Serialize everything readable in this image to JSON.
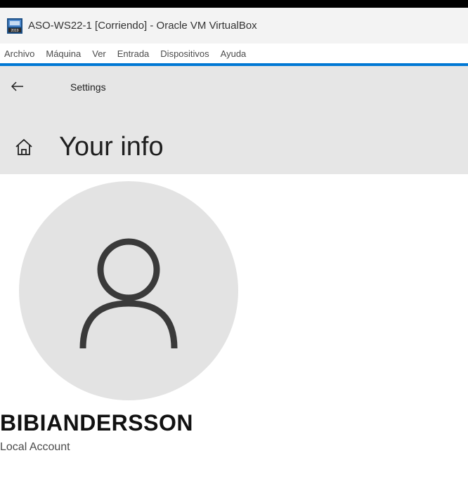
{
  "window": {
    "title": "ASO-WS22-1 [Corriendo] - Oracle VM VirtualBox",
    "app_icon": "virtualbox-icon"
  },
  "menubar": {
    "items": [
      "Archivo",
      "Máquina",
      "Ver",
      "Entrada",
      "Dispositivos",
      "Ayuda"
    ]
  },
  "settings": {
    "back_icon": "back-arrow-icon",
    "app_label": "Settings",
    "home_icon": "home-icon",
    "page_title": "Your info"
  },
  "profile": {
    "avatar_icon": "person-icon",
    "user_name": "BIBIANDERSSON",
    "account_type": "Local Account"
  },
  "colors": {
    "accent": "#0078d4",
    "header_bg": "#e6e6e6",
    "avatar_bg": "#e3e3e3",
    "avatar_fg": "#3a3a3a"
  }
}
